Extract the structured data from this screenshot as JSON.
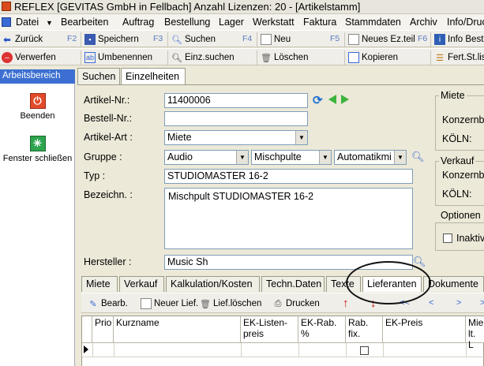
{
  "window": {
    "title": "REFLEX [GEVITAS GmbH in Fellbach] Anzahl Lizenzen: 20 - [Artikelstamm]"
  },
  "menu": {
    "items": [
      "Datei",
      "Bearbeiten",
      "Auftrag",
      "Bestellung",
      "Lager",
      "Werkstatt",
      "Faktura",
      "Stammdaten",
      "Archiv",
      "Info/Drucken"
    ]
  },
  "toolbar1": {
    "back": "Zurück",
    "back_key": "F2",
    "save": "Speichern",
    "save_key": "F3",
    "search": "Suchen",
    "search_key": "F4",
    "new": "Neu",
    "new_key": "F5",
    "new_part": "Neues Ez.teil",
    "new_part_key": "F6",
    "info": "Info Best"
  },
  "toolbar2": {
    "discard": "Verwerfen",
    "rename": "Umbenennen",
    "single_search": "Einz.suchen",
    "delete": "Löschen",
    "copy": "Kopieren",
    "fert": "Fert.St.lis"
  },
  "sidebar": {
    "header": "Arbeitsbereich",
    "items": [
      {
        "label": "Beenden"
      },
      {
        "label": "Fenster schließen"
      }
    ]
  },
  "top_tabs": [
    "Suchen",
    "Einzelheiten"
  ],
  "form": {
    "artikel_nr_label": "Artikel-Nr.:",
    "artikel_nr_value": "11400006",
    "bestell_nr_label": "Bestell-Nr.:",
    "bestell_nr_value": "",
    "artikel_art_label": "Artikel-Art :",
    "artikel_art_value": "Miete",
    "gruppe_label": "Gruppe :",
    "gruppe_1": "Audio",
    "gruppe_2": "Mischpulte",
    "gruppe_3": "Automatikmi",
    "typ_label": "Typ :",
    "typ_value": "STUDIOMASTER 16-2",
    "bezeichn_label": "Bezeichn. :",
    "bezeichn_value": "Mischpult STUDIOMASTER 16-2",
    "hersteller_label": "Hersteller :",
    "hersteller_value": "Music Sh"
  },
  "right_panel": {
    "miete_title": "Miete",
    "miete_konzern": "Konzernb",
    "miete_koeln": "KÖLN:",
    "verkauf_title": "Verkauf",
    "verkauf_konzern": "Konzernb",
    "verkauf_koeln": "KÖLN:",
    "optionen_title": "Optionen",
    "inaktiv": "Inaktiv"
  },
  "bottom_tabs": [
    "Miete",
    "Verkauf",
    "Kalkulation/Kosten",
    "Techn.Daten",
    "Texte",
    "Lieferanten",
    "Dokumente"
  ],
  "subtoolbar": {
    "edit": "Bearb.",
    "new_supplier": "Neuer Lief.",
    "delete_supplier": "Lief.löschen",
    "print": "Drucken",
    "nav_first": "<<",
    "nav_prev": "<",
    "nav_next": ">",
    "nav_last": ">"
  },
  "grid": {
    "columns": [
      "Prio",
      "Kurzname",
      "EK-Listen-preis",
      "EK-Rab. %",
      "Rab. fix.",
      "EK-Preis",
      "Mie lt. L"
    ]
  }
}
